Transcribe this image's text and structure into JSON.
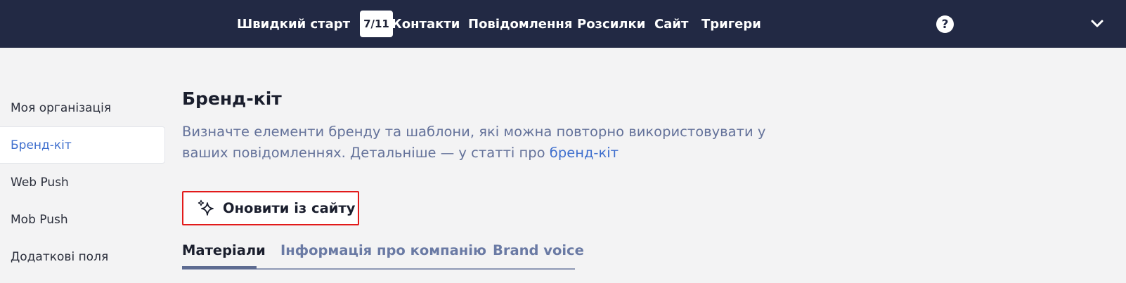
{
  "nav": {
    "quickstart_label": "Швидкий старт",
    "quickstart_progress": "7/11",
    "items": [
      {
        "label": "Контакти"
      },
      {
        "label": "Повідомлення"
      },
      {
        "label": "Розсилки"
      },
      {
        "label": "Сайт"
      },
      {
        "label": "Тригери"
      }
    ],
    "help_glyph": "?"
  },
  "sidebar": {
    "items": [
      {
        "label": "Моя організація"
      },
      {
        "label": "Бренд-кіт",
        "active": true
      },
      {
        "label": "Web Push"
      },
      {
        "label": "Mob Push"
      },
      {
        "label": "Додаткові поля"
      }
    ]
  },
  "main": {
    "title": "Бренд-кіт",
    "description": "Визначте елементи бренду та шаблони, які можна повторно використовувати у ваших повідомленнях. Детальніше — у статті про ",
    "description_link": "бренд-кіт",
    "refresh_button": "Оновити із сайту",
    "tabs": [
      {
        "label": "Матеріали",
        "active": true
      },
      {
        "label": "Інформація про компанію"
      },
      {
        "label": "Brand voice"
      }
    ]
  },
  "colors": {
    "topbar": "#222944",
    "accent": "#3f6fce",
    "highlight_border": "#e21a1a"
  },
  "icons": [
    "help-icon",
    "chevron-down-icon",
    "sparkle-icon"
  ]
}
